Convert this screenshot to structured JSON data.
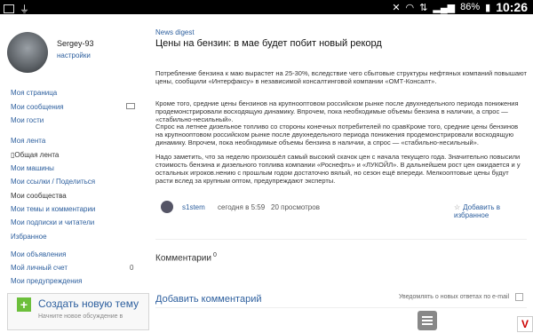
{
  "status_bar": {
    "battery": "86%",
    "time": "10:26",
    "icons": [
      "image-icon",
      "usb-icon",
      "mute-icon",
      "wifi-icon",
      "data-arrows-icon",
      "signal-icon",
      "battery-icon"
    ]
  },
  "sidebar": {
    "username": "Sergey-93",
    "settings": "настройки",
    "nav": [
      {
        "label": "Моя страница"
      },
      {
        "label": "Мои сообщения"
      },
      {
        "label": "Мои гости"
      },
      {
        "label": "Моя лента"
      },
      {
        "label": "Общая лента"
      },
      {
        "label": "Мои машины"
      },
      {
        "label": "Мои ссылки / Поделиться"
      },
      {
        "label": "Мои сообщества"
      },
      {
        "label": "Мои темы и комментарии"
      },
      {
        "label": "Мои подписки и читатели"
      },
      {
        "label": "Избранное"
      },
      {
        "label": "Мои объявления"
      },
      {
        "label": "Мой личный счет",
        "count": "0"
      },
      {
        "label": "Мои предупреждения"
      }
    ],
    "create": {
      "title": "Создать новую тему",
      "subtitle": "Начните новое обсуждение в"
    }
  },
  "article": {
    "breadcrumb": "News digest",
    "title": "Цены на бензин: в мае будет побит новый рекорд",
    "paragraphs": [
      "Потребление бензина к маю вырастет на 25-30%, вследствие чего сбытовые структуры нефтяных компаний повышают цены, сообщили «Интерфаксу» в независимой консалтинговой компании «ОМТ-Консалт».",
      "Кроме того, средние цены бензинов на крупнооптовом российском рынке после двухнедельного периода понижения продемонстрировали восходящую динамику. Впрочем, пока необходимые объемы бензина в наличии, а спрос — «стабильно-несильный».",
      "Спрос на летнее дизельное топливо со стороны конечных потребителей по сравКроме того, средние цены бензинов на крупнооптовом российском рынке после двухнедельного периода понижения продемонстрировали восходящую динамику. Впрочем, пока необходимые объемы бензина в наличии, а спрос — «стабильно-несильный».",
      "Надо заметить, что за неделю произошёл самый высокий скачок цен с начала текущего года. Значительно повысили стоимость бензина и дизельного топлива компании «Роснефть» и «ЛУКОЙЛ». В дальнейшем рост цен ожидается и у остальных игроков.нению с прошлым годом достаточно вялый, но сезон ещё впереди. Мелкооптовые цены будут расти вслед за крупным оптом, предупреждают эксперты."
    ],
    "author": "s1stem",
    "date": "сегодня в 5:59",
    "views": "20 просмотров",
    "favorite": "Добавить в избранное"
  },
  "comments": {
    "heading": "Комментарии",
    "count": "0",
    "add": "Добавить комментарий",
    "notify": "Уведомлять о новых ответах по e-mail"
  },
  "colors": {
    "link": "#2d5f9e",
    "accent_green": "#6cbf3b"
  }
}
